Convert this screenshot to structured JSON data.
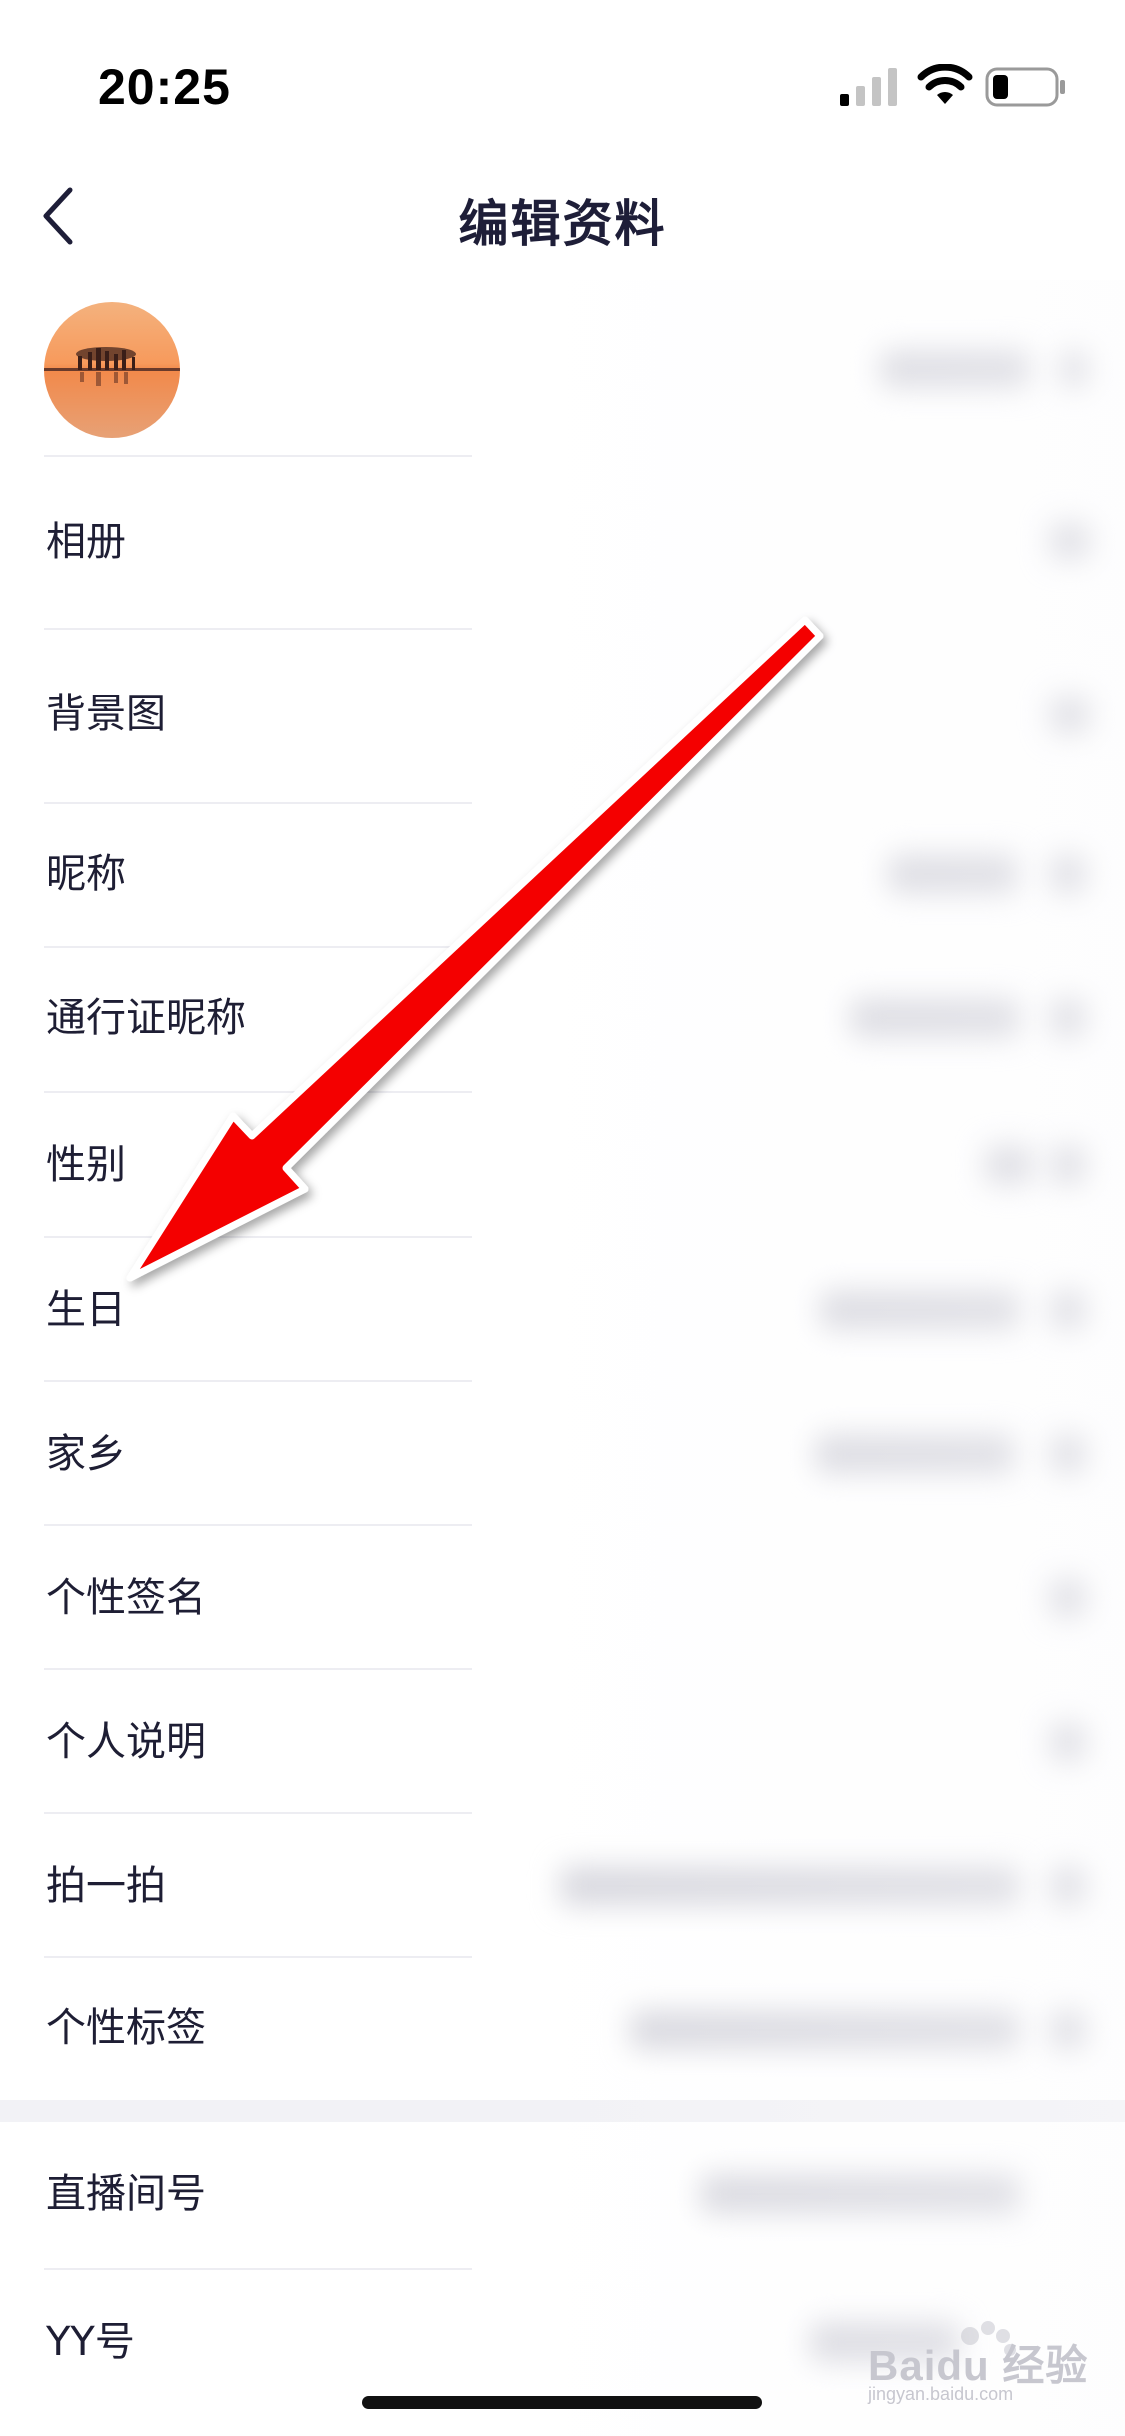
{
  "status_bar": {
    "time": "20:25",
    "icons": [
      "signal-icon",
      "wifi-icon",
      "battery-icon"
    ]
  },
  "nav": {
    "back_icon": "chevron-left-icon",
    "title": "编辑资料"
  },
  "list": {
    "items": [
      {
        "label": "相册"
      },
      {
        "label": "背景图"
      },
      {
        "label": "昵称"
      },
      {
        "label": "通行证昵称"
      },
      {
        "label": "性别"
      },
      {
        "label": "生日"
      },
      {
        "label": "家乡"
      },
      {
        "label": "个性签名"
      },
      {
        "label": "个人说明"
      },
      {
        "label": "拍一拍"
      },
      {
        "label": "个性标签"
      },
      {
        "label": "直播间号"
      },
      {
        "label": "YY号"
      }
    ]
  },
  "annotation": {
    "arrow_color": "#ff0000",
    "points_to": "生日"
  },
  "watermark": {
    "text": "Baidu 经验",
    "sub": "jingyan.baidu.com"
  }
}
